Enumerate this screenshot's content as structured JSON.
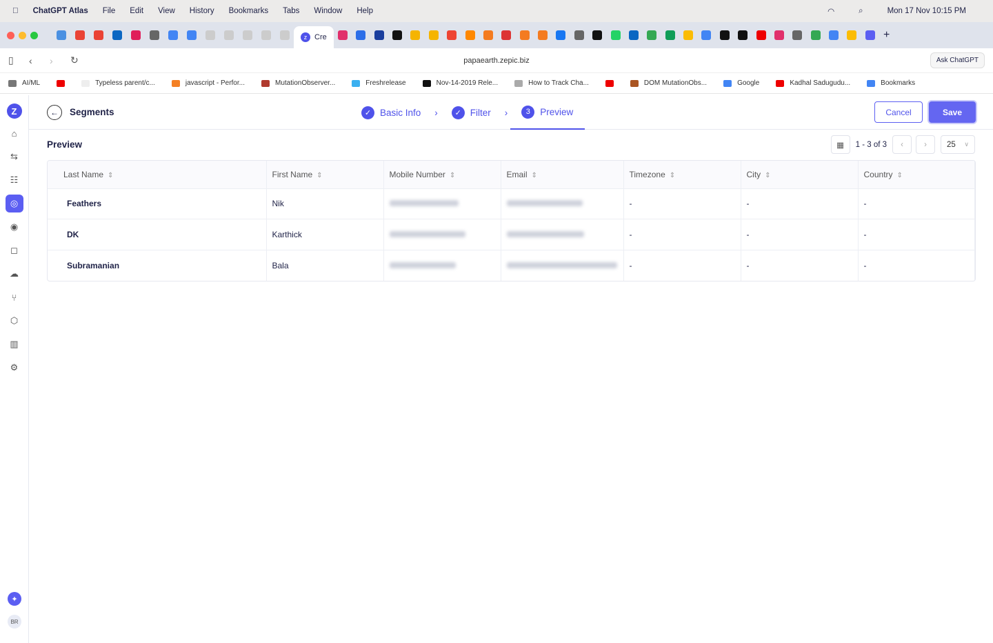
{
  "menubar": {
    "app": "ChatGPT Atlas",
    "items": [
      "File",
      "Edit",
      "View",
      "History",
      "Bookmarks",
      "Tabs",
      "Window",
      "Help"
    ],
    "clock": "Mon 17 Nov  10:15 PM"
  },
  "browser": {
    "active_tab": "Cre",
    "url": "papaearth.zepic.biz",
    "ask": "Ask ChatGPT",
    "tab_colors": [
      "#4a90e2",
      "#ea4335",
      "#ea4335",
      "#0a66c2",
      "#e01e5a",
      "#666",
      "#4285f4",
      "#4285f4",
      "#ccc",
      "#ccc",
      "#ccc",
      "#ccc",
      "#ccc"
    ],
    "tab_colors_right": [
      "#e1306c",
      "#2c6ee8",
      "#1a3e9e",
      "#111",
      "#f5b400",
      "#f5b400",
      "#e43",
      "#f80",
      "#f47b20",
      "#d33",
      "#f47b20",
      "#f47b20",
      "#1877f2",
      "#666",
      "#111",
      "#25d366",
      "#0a66c2",
      "#34a853",
      "#0f9d58",
      "#fbbc04",
      "#4285f4",
      "#111",
      "#111",
      "#e00",
      "#e1306c",
      "#666",
      "#34a853",
      "#4285f4",
      "#fbbc04",
      "#5b5ef2"
    ],
    "bookmarks": [
      {
        "label": "AI/ML",
        "color": "#777"
      },
      {
        "label": "",
        "color": "#e00"
      },
      {
        "label": "Typeless parent/c...",
        "color": "#eee"
      },
      {
        "label": "javascript - Perfor...",
        "color": "#f48024"
      },
      {
        "label": "MutationObserver...",
        "color": "#b03a2e"
      },
      {
        "label": "Freshrelease",
        "color": "#3bb0f0"
      },
      {
        "label": "Nov-14-2019 Rele...",
        "color": "#111"
      },
      {
        "label": "How to Track Cha...",
        "color": "#aaa"
      },
      {
        "label": "",
        "color": "#e00"
      },
      {
        "label": "DOM MutationObs...",
        "color": "#a52"
      },
      {
        "label": "Google",
        "color": "#4285f4"
      },
      {
        "label": "Kadhal Sadugudu...",
        "color": "#e00"
      },
      {
        "label": "Bookmarks",
        "color": "#4285f4"
      }
    ]
  },
  "app": {
    "title": "Segments",
    "steps": [
      {
        "label": "Basic Info",
        "state": "done"
      },
      {
        "label": "Filter",
        "state": "done"
      },
      {
        "label": "Preview",
        "number": "3",
        "state": "current"
      }
    ],
    "cancel": "Cancel",
    "save": "Save",
    "section": "Preview",
    "pagination": "1 - 3 of 3",
    "page_size": "25",
    "avatar": "BR",
    "accent": "#4f52ea"
  },
  "table": {
    "columns": [
      "Last Name",
      "First Name",
      "Mobile Number",
      "Email",
      "Timezone",
      "City",
      "Country"
    ],
    "rows": [
      {
        "last": "Feathers",
        "first": "Nik",
        "tz": "-",
        "city": "-",
        "country": "-"
      },
      {
        "last": "DK",
        "first": "Karthick",
        "tz": "-",
        "city": "-",
        "country": "-"
      },
      {
        "last": "Subramanian",
        "first": "Bala",
        "tz": "-",
        "city": "-",
        "country": "-"
      }
    ]
  }
}
